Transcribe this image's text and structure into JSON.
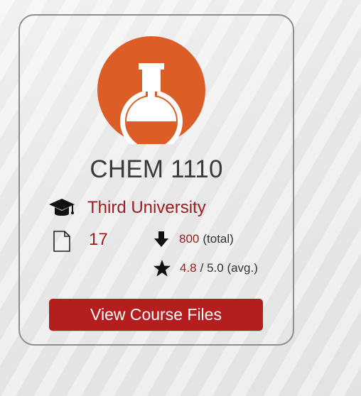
{
  "course": {
    "code": "CHEM 1110",
    "logo_icon": "flask-icon",
    "logo_color": "#dd5d27"
  },
  "university": {
    "icon": "graduation-cap-icon",
    "name": "Third University"
  },
  "stats": {
    "files_icon": "file-icon",
    "files_count": "17",
    "downloads_icon": "download-arrow-icon",
    "downloads_value": "800",
    "downloads_suffix": "(total)",
    "rating_icon": "star-icon",
    "rating_value": "4.8",
    "rating_suffix": "/ 5.0 (avg.)"
  },
  "actions": {
    "view_files_label": "View Course Files"
  },
  "colors": {
    "accent": "#b41e1e",
    "text_accent": "#9f1b1b",
    "card_border": "#8e8e8e"
  }
}
